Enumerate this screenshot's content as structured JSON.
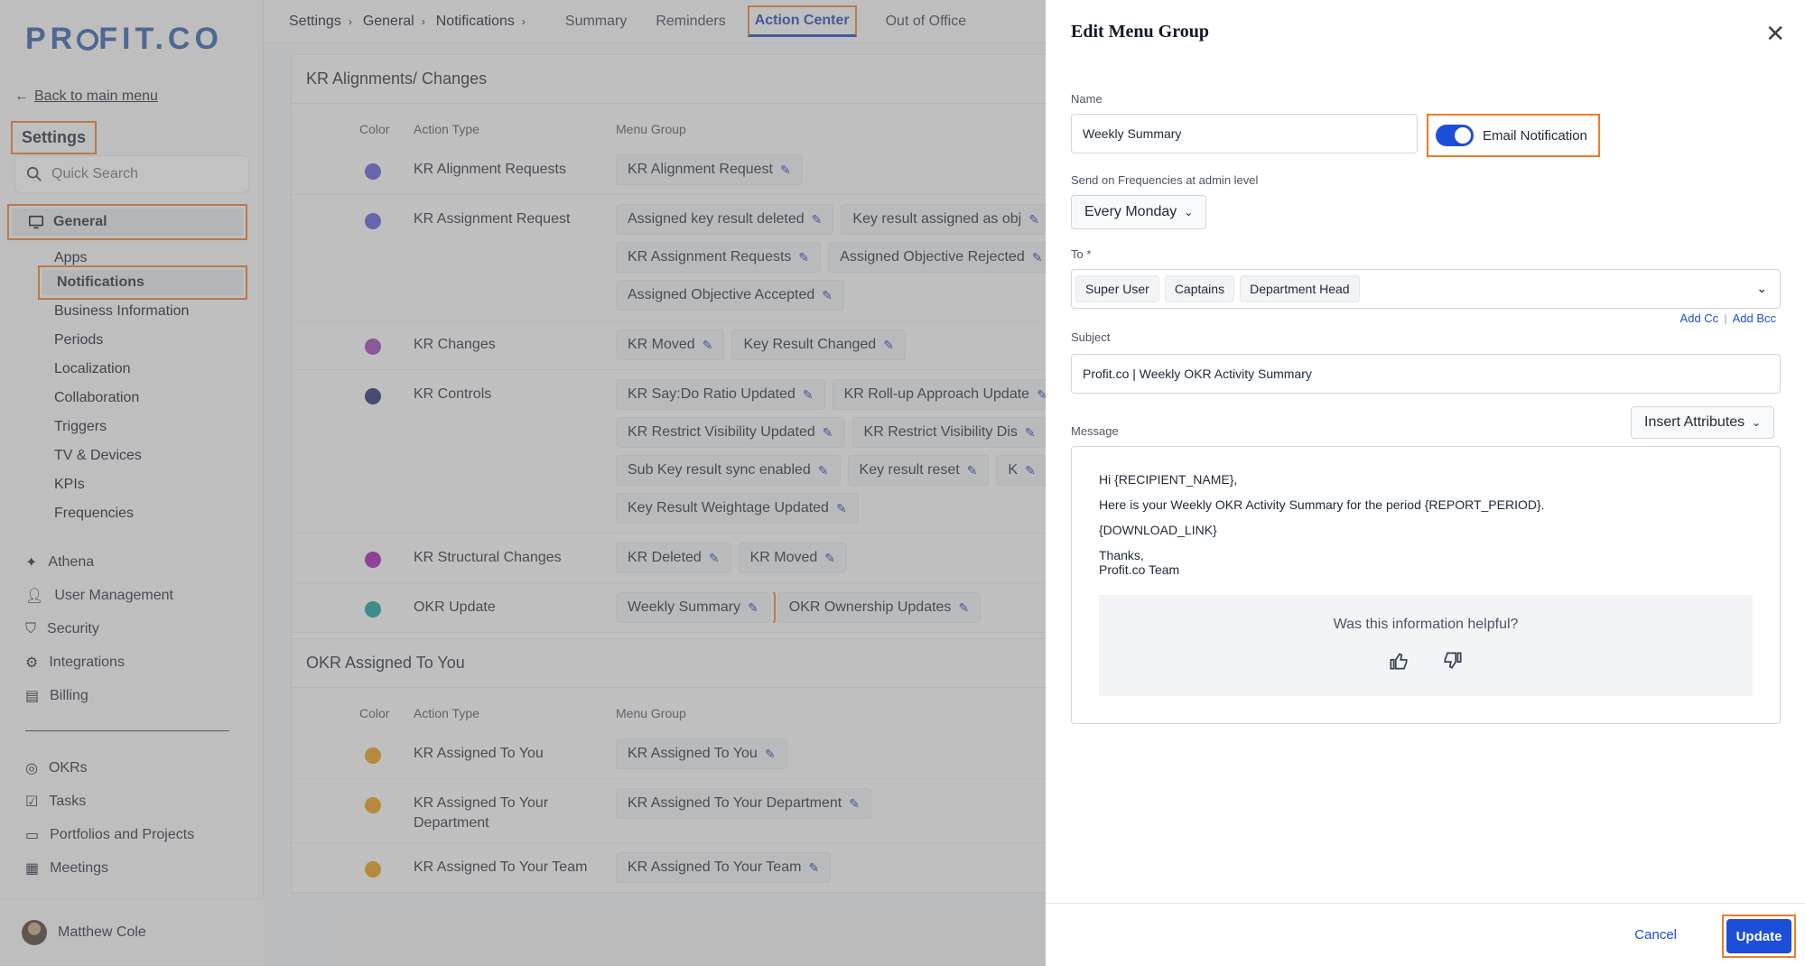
{
  "sidebar": {
    "logo": "PROFIT.CO",
    "back_link": "Back to main menu",
    "title": "Settings",
    "search_placeholder": "Quick Search",
    "general": "General",
    "sub_items": [
      "Apps",
      "Notifications",
      "Business Information",
      "Periods",
      "Localization",
      "Collaboration",
      "Triggers",
      "TV & Devices",
      "KPIs",
      "Frequencies"
    ],
    "nav1": [
      "Athena",
      "User Management",
      "Security",
      "Integrations",
      "Billing"
    ],
    "nav2": [
      "OKRs",
      "Tasks",
      "Portfolios and Projects",
      "Meetings"
    ],
    "user_name": "Matthew Cole"
  },
  "topbar": {
    "crumbs": [
      "Settings",
      "General",
      "Notifications"
    ],
    "tabs": [
      "Summary",
      "Reminders",
      "Action Center",
      "Out of Office"
    ],
    "active_tab": "Action Center"
  },
  "section1": {
    "title": "KR Alignments/ Changes",
    "headers": [
      "Color",
      "Action Type",
      "Menu Group"
    ],
    "rows": [
      {
        "color": "#5a57d6",
        "type": "KR Alignment Requests",
        "chips": [
          "KR Alignment Request"
        ]
      },
      {
        "color": "#5a57d6",
        "type": "KR Assignment Request",
        "chips": [
          "Assigned key result deleted",
          "Key result assigned as obj",
          "KR Assignment Requests",
          "Assigned Objective Rejected",
          "Assigned Objective Accepted"
        ]
      },
      {
        "color": "#9b3fb5",
        "type": "KR Changes",
        "chips": [
          "KR Moved",
          "Key Result Changed"
        ]
      },
      {
        "color": "#202a6b",
        "type": "KR Controls",
        "chips": [
          "KR Say:Do Ratio Updated",
          "KR Roll-up Approach Update",
          "KR Restrict Visibility Updated",
          "KR Restrict Visibility Dis",
          "Sub Key result sync enabled",
          "Key result reset",
          "K",
          "Key Result Weightage Updated"
        ]
      },
      {
        "color": "#a416b0",
        "type": "KR Structural Changes",
        "chips": [
          "KR Deleted",
          "KR Moved"
        ]
      },
      {
        "color": "#129a9a",
        "type": "OKR Update",
        "chips": [
          "Weekly Summary",
          "OKR Ownership Updates"
        ]
      }
    ]
  },
  "section2": {
    "title": "OKR Assigned To You",
    "headers": [
      "Color",
      "Action Type",
      "Menu Group"
    ],
    "rows": [
      {
        "color": "#e89a10",
        "type": "KR Assigned To You",
        "chips": [
          "KR Assigned To You"
        ]
      },
      {
        "color": "#e89a10",
        "type": "KR Assigned To Your Department",
        "chips": [
          "KR Assigned To Your Department"
        ]
      },
      {
        "color": "#e89a10",
        "type": "KR Assigned To Your Team",
        "chips": [
          "KR Assigned To Your Team"
        ]
      }
    ]
  },
  "drawer": {
    "title": "Edit Menu Group",
    "name_label": "Name",
    "name_value": "Weekly Summary",
    "email_notification": "Email Notification",
    "freq_label": "Send on Frequencies at admin level",
    "freq_value": "Every Monday",
    "to_label": "To *",
    "to_tags": [
      "Super User",
      "Captains",
      "Department Head"
    ],
    "add_cc": "Add Cc",
    "add_bcc": "Add Bcc",
    "subject_label": "Subject",
    "subject_value": "Profit.co | Weekly OKR Activity Summary",
    "message_label": "Message",
    "insert_attributes": "Insert Attributes",
    "message_lines": [
      "Hi {RECIPIENT_NAME},",
      "Here is your Weekly OKR Activity Summary for the period {REPORT_PERIOD}.",
      "{DOWNLOAD_LINK}"
    ],
    "thanks": "Thanks,",
    "team": "Profit.co Team",
    "helpful": "Was this information helpful?",
    "cancel": "Cancel",
    "update": "Update"
  }
}
